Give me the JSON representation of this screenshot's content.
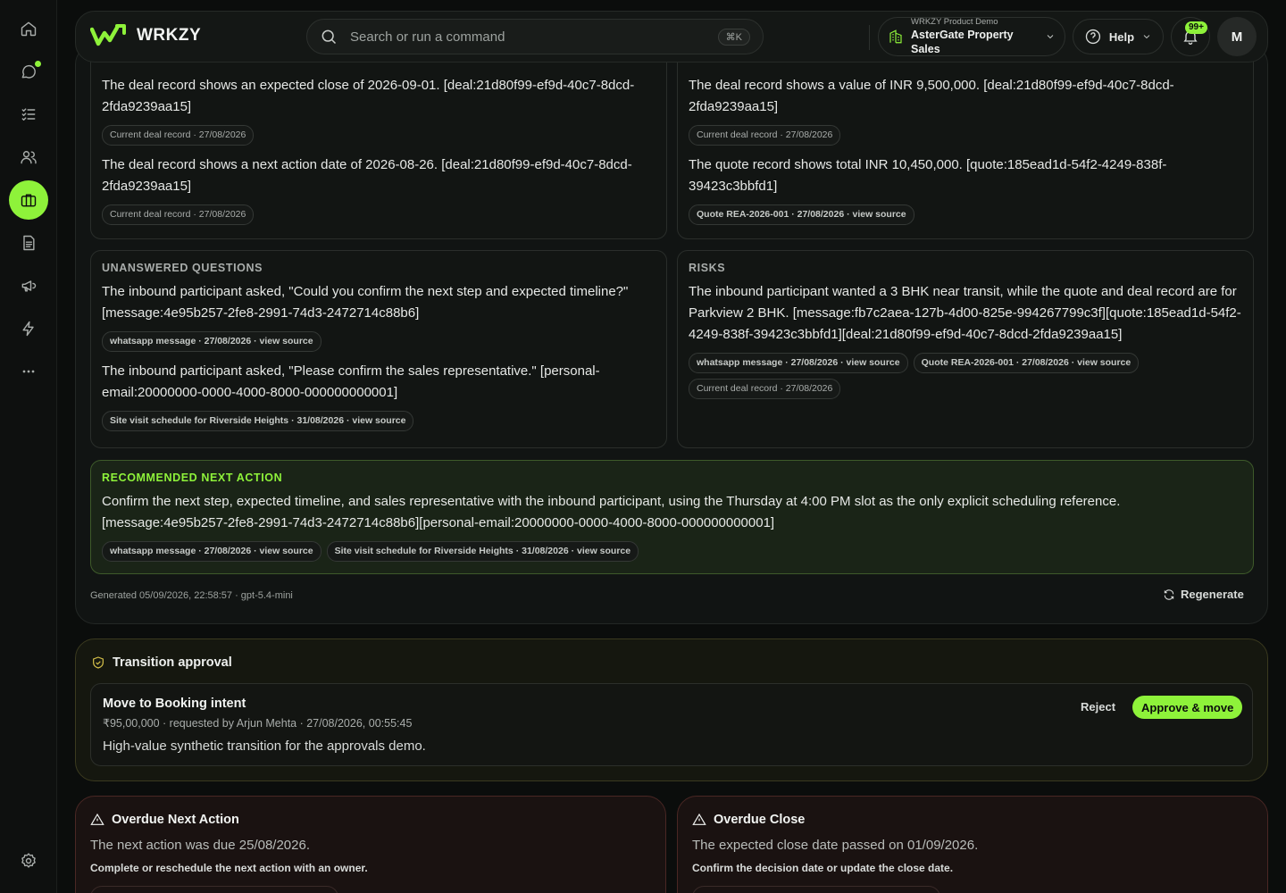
{
  "app": {
    "name": "WRKZY"
  },
  "search": {
    "placeholder": "Search or run a command",
    "shortcut": "⌘K"
  },
  "org": {
    "label": "WRKZY Product Demo",
    "name": "AsterGate Property Sales"
  },
  "help": {
    "label": "Help"
  },
  "notifications": {
    "count": "99+"
  },
  "user": {
    "initial": "M"
  },
  "sidebar": {
    "items": [
      {
        "icon": "home-icon"
      },
      {
        "icon": "chat-icon"
      },
      {
        "icon": "tasks-icon"
      },
      {
        "icon": "contacts-icon"
      },
      {
        "icon": "briefcase-icon",
        "active": true
      },
      {
        "icon": "document-icon"
      },
      {
        "icon": "megaphone-icon"
      },
      {
        "icon": "bolt-icon"
      },
      {
        "icon": "more-icon"
      },
      {
        "icon": "settings-icon"
      }
    ]
  },
  "summary": {
    "top_left": [
      {
        "text": "The deal record shows an expected close of 2026-09-01. [deal:21d80f99-ef9d-40c7-8dcd-2fda9239aa15]",
        "chips": [
          "Current deal record · 27/08/2026"
        ]
      },
      {
        "text": "The deal record shows a next action date of 2026-08-26. [deal:21d80f99-ef9d-40c7-8dcd-2fda9239aa15]",
        "chips": [
          "Current deal record · 27/08/2026"
        ]
      }
    ],
    "top_right": [
      {
        "text": "The deal record shows a value of INR 9,500,000. [deal:21d80f99-ef9d-40c7-8dcd-2fda9239aa15]",
        "chips": [
          "Current deal record · 27/08/2026"
        ]
      },
      {
        "text": "The quote record shows total INR 10,450,000. [quote:185ead1d-54f2-4249-838f-39423c3bbfd1]",
        "chips": [
          "Quote REA-2026-001 · 27/08/2026 · view source"
        ]
      }
    ],
    "unanswered": {
      "title": "UNANSWERED QUESTIONS",
      "items": [
        {
          "text": "The inbound participant asked, \"Could you confirm the next step and expected timeline?\" [message:4e95b257-2fe8-2991-74d3-2472714c88b6]",
          "chips": [
            "whatsapp message · 27/08/2026 · view source"
          ]
        },
        {
          "text": "The inbound participant asked, \"Please confirm the sales representative.\" [personal-email:20000000-0000-4000-8000-000000000001]",
          "chips": [
            "Site visit schedule for Riverside Heights · 31/08/2026 · view source"
          ]
        }
      ]
    },
    "risks": {
      "title": "RISKS",
      "items": [
        {
          "text": "The inbound participant wanted a 3 BHK near transit, while the quote and deal record are for Parkview 2 BHK. [message:fb7c2aea-127b-4d00-825e-994267799c3f][quote:185ead1d-54f2-4249-838f-39423c3bbfd1][deal:21d80f99-ef9d-40c7-8dcd-2fda9239aa15]",
          "chips": [
            "whatsapp message · 27/08/2026 · view source",
            "Quote REA-2026-001 · 27/08/2026 · view source",
            "Current deal record · 27/08/2026"
          ]
        }
      ]
    },
    "recommended": {
      "title": "RECOMMENDED NEXT ACTION",
      "text": "Confirm the next step, expected timeline, and sales representative with the inbound participant, using the Thursday at 4:00 PM slot as the only explicit scheduling reference. [message:4e95b257-2fe8-2991-74d3-2472714c88b6][personal-email:20000000-0000-4000-8000-000000000001]",
      "chips": [
        "whatsapp message · 27/08/2026 · view source",
        "Site visit schedule for Riverside Heights · 31/08/2026 · view source"
      ]
    },
    "generated": "Generated 05/09/2026, 22:58:57 · gpt-5.4-mini",
    "regenerate_label": "Regenerate"
  },
  "approval": {
    "title": "Transition approval",
    "move_title": "Move to Booking intent",
    "meta": "₹95,00,000 · requested by Arjun Mehta · 27/08/2026, 00:55:45",
    "description": "High-value synthetic transition for the approvals demo.",
    "reject_label": "Reject",
    "approve_label": "Approve & move"
  },
  "overdue": [
    {
      "title": "Overdue Next Action",
      "description": "The next action was due 25/08/2026.",
      "hint": "Complete or reschedule the next action with an owner."
    },
    {
      "title": "Overdue Close",
      "description": "The expected close date passed on 01/09/2026.",
      "hint": "Confirm the decision date or update the close date."
    }
  ],
  "colors": {
    "accent": "#8ef23a",
    "warning": "#d7c24a",
    "danger": "#4a2724"
  }
}
